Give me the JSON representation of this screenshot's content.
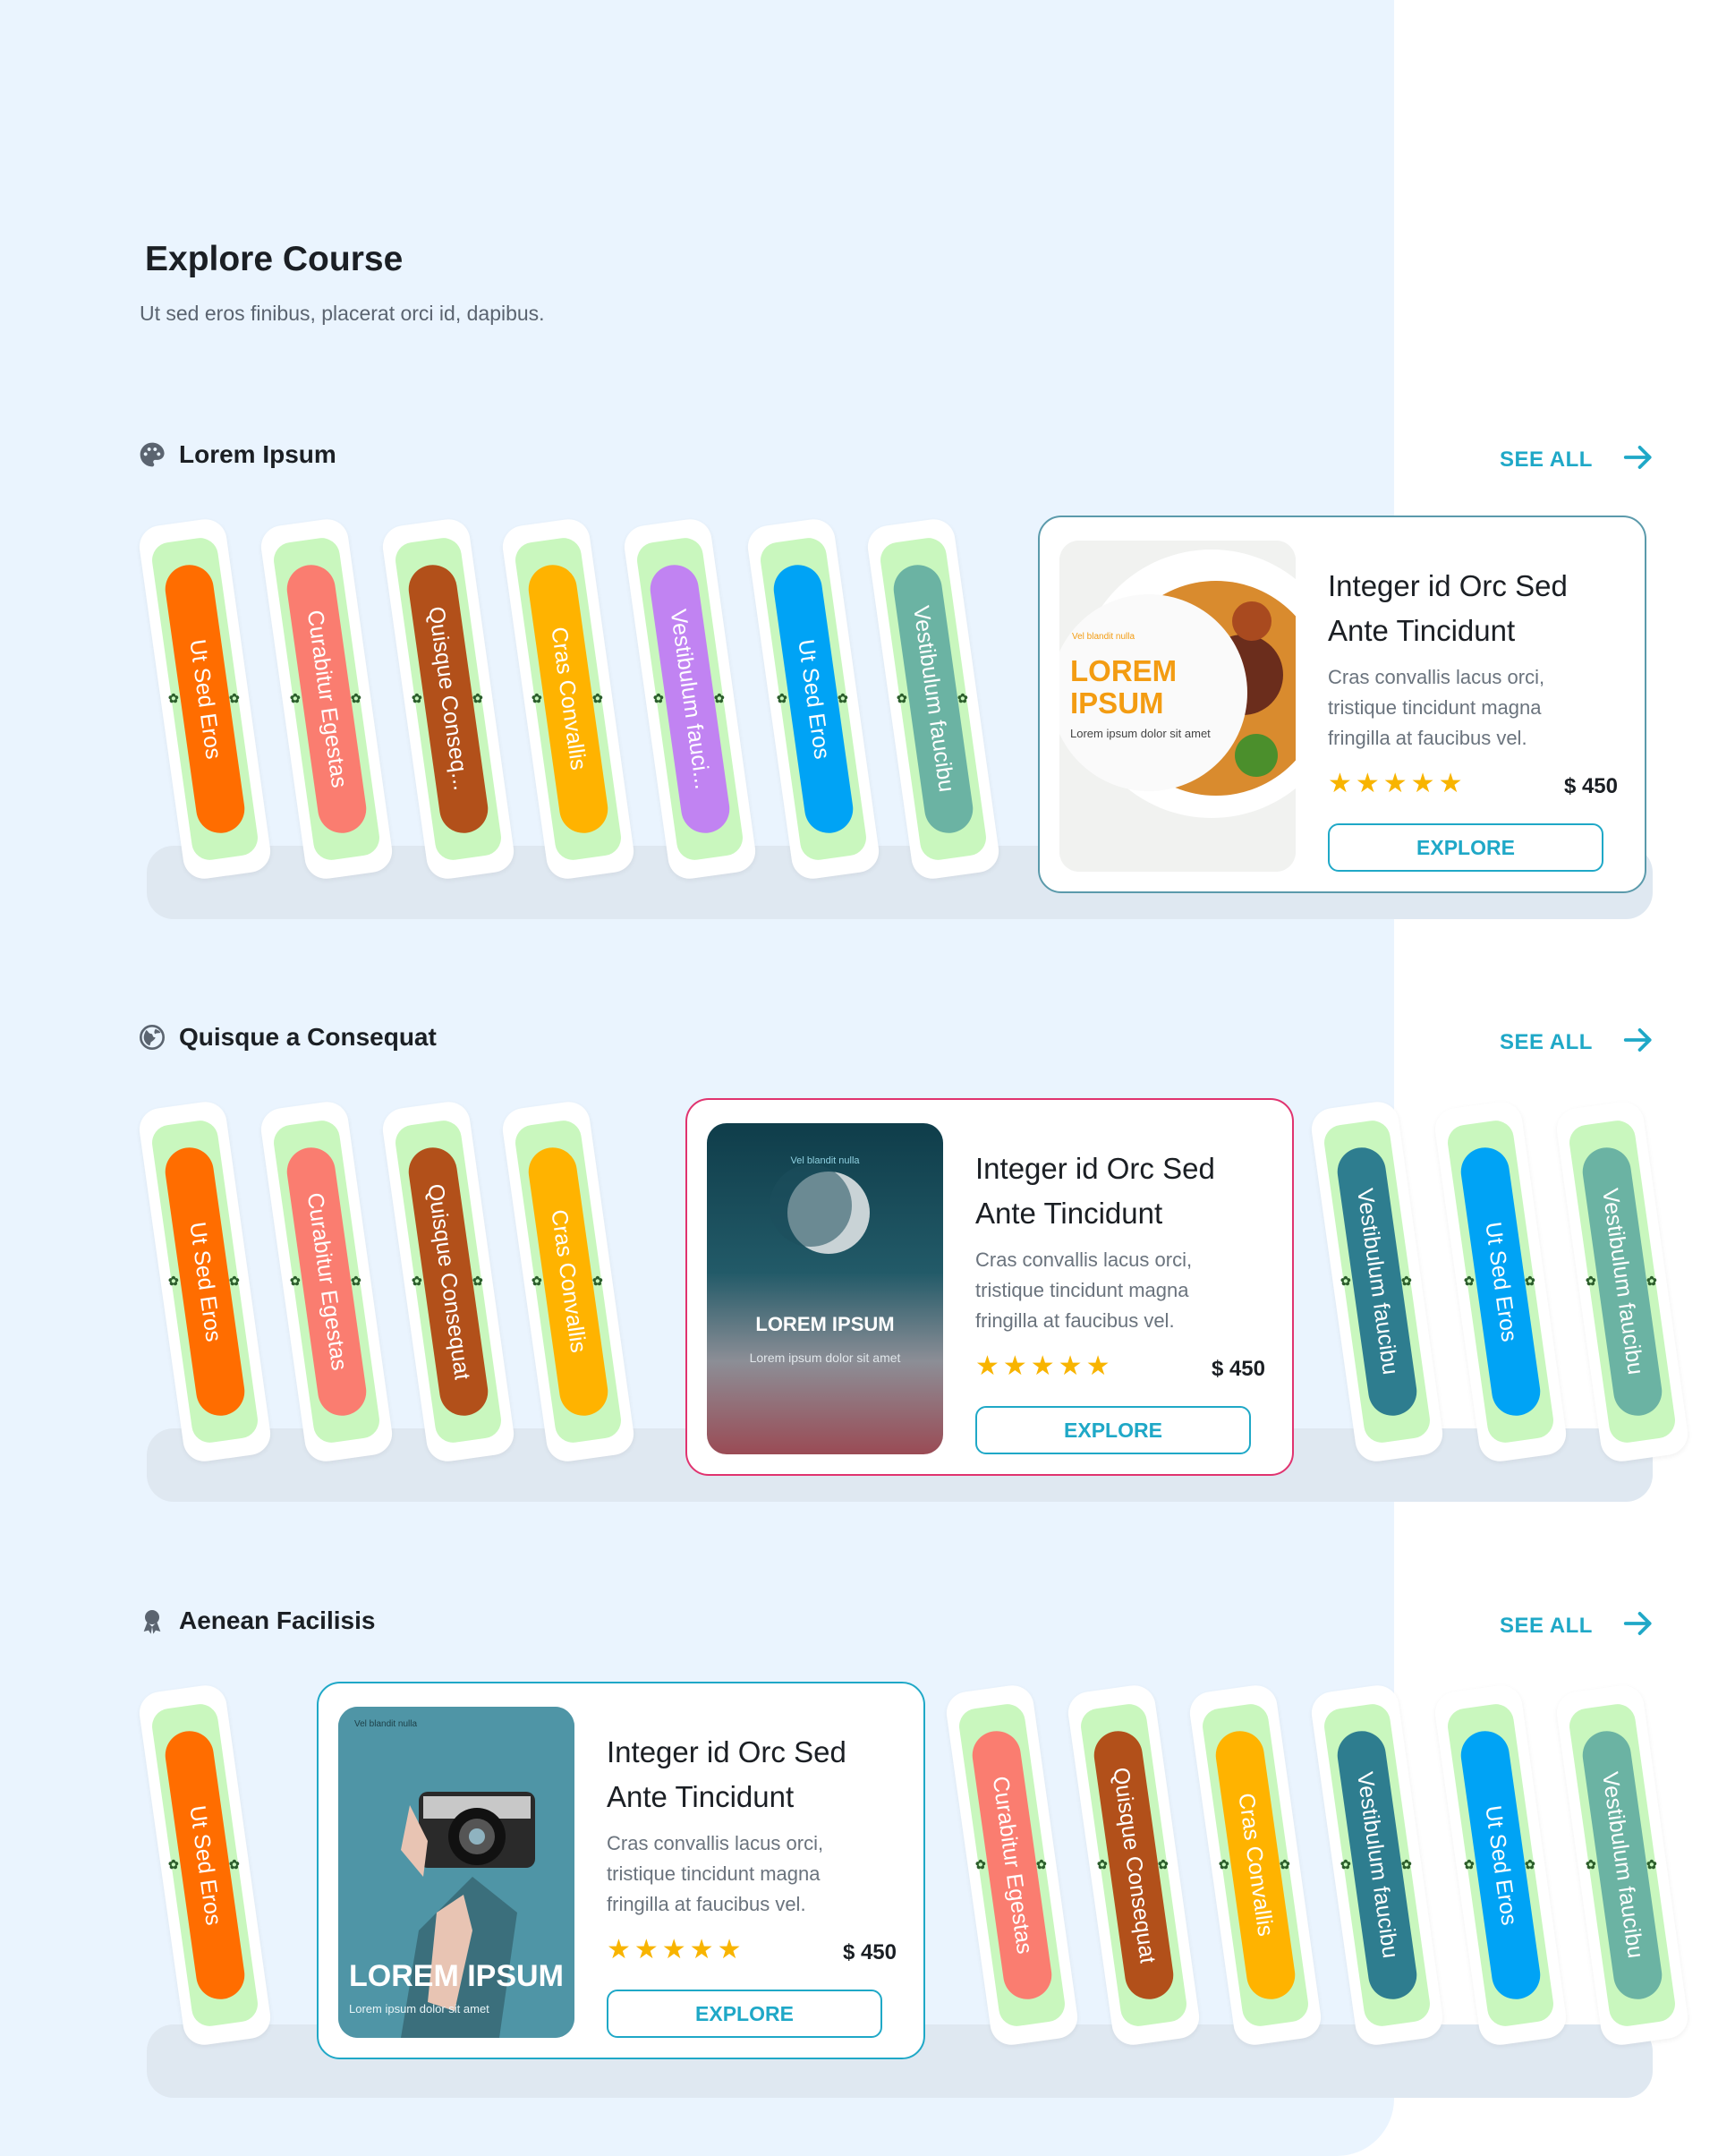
{
  "page": {
    "title": "Explore Course",
    "subtitle": "Ut sed eros finibus, placerat orci id, dapibus."
  },
  "colors": {
    "accent": "#1fa8c7",
    "background": "#eaf4fe",
    "star": "#f8b400",
    "spine_green": "#c9f7be"
  },
  "sections": [
    {
      "icon": "palette-icon",
      "title": "Lorem Ipsum",
      "see_all": "SEE ALL",
      "spines": [
        {
          "label": "Ut Sed Eros",
          "color": "#ff6d00"
        },
        {
          "label": "Curabitur Egestas",
          "color": "#fa7d70"
        },
        {
          "label": "Quisque Conseq...",
          "color": "#b2501a"
        },
        {
          "label": "Cras Convallis",
          "color": "#ffb300"
        },
        {
          "label": "Vestibulum fauci...",
          "color": "#c183f2"
        },
        {
          "label": "Ut Sed Eros",
          "color": "#00a3f5"
        },
        {
          "label": "Vestibulum faucibu",
          "color": "#6bb3a3"
        }
      ],
      "card": {
        "border": "#5b9aab",
        "title": "Integer id Orc Sed Ante Tincidunt",
        "description": "Cras convallis lacus orci, tristique tincidunt magna fringilla at faucibus vel.",
        "rating": "★★★★★",
        "price": "$ 450",
        "button": "EXPLORE",
        "cover": {
          "kicker": "Vel blandit nulla",
          "title": "LOREM IPSUM",
          "caption": "Lorem ipsum dolor sit amet"
        }
      }
    },
    {
      "icon": "globe-icon",
      "title": "Quisque a Consequat",
      "see_all": "SEE ALL",
      "spines_left": [
        {
          "label": "Ut Sed Eros",
          "color": "#ff6d00"
        },
        {
          "label": "Curabitur Egestas",
          "color": "#fa7d70"
        },
        {
          "label": "Quisque Consequat",
          "color": "#b2501a"
        },
        {
          "label": "Cras Convallis",
          "color": "#ffb300"
        }
      ],
      "spines_right": [
        {
          "label": "Vestibulum faucibu",
          "color": "#2e7d8f"
        },
        {
          "label": "Ut Sed Eros",
          "color": "#00a3f5"
        },
        {
          "label": "Vestibulum faucibu",
          "color": "#6bb3a3"
        }
      ],
      "card": {
        "border": "#e0336f",
        "title": "Integer id Orc Sed Ante Tincidunt",
        "description": "Cras convallis lacus orci, tristique tincidunt magna fringilla at faucibus vel.",
        "rating": "★★★★★",
        "price": "$ 450",
        "button": "EXPLORE",
        "cover": {
          "kicker": "Vel blandit nulla",
          "title": "LOREM IPSUM",
          "caption": "Lorem ipsum dolor sit amet"
        }
      }
    },
    {
      "icon": "award-icon",
      "title": "Aenean Facilisis",
      "see_all": "SEE ALL",
      "spines_left": [
        {
          "label": "Ut Sed Eros",
          "color": "#ff6d00"
        }
      ],
      "spines_right": [
        {
          "label": "Curabitur Egestas",
          "color": "#fa7d70"
        },
        {
          "label": "Quisque Consequat",
          "color": "#b2501a"
        },
        {
          "label": "Cras Convallis",
          "color": "#ffb300"
        },
        {
          "label": "Vestibulum faucibu",
          "color": "#2e7d8f"
        },
        {
          "label": "Ut Sed Eros",
          "color": "#00a3f5"
        },
        {
          "label": "Vestibulum faucibu",
          "color": "#6bb3a3"
        }
      ],
      "card": {
        "border": "#1fa8c7",
        "title": "Integer id Orc Sed Ante Tincidunt",
        "description": "Cras convallis lacus orci, tristique tincidunt magna fringilla at faucibus vel.",
        "rating": "★★★★★",
        "price": "$ 450",
        "button": "EXPLORE",
        "cover": {
          "kicker": "Vel blandit nulla",
          "title": "LOREM IPSUM",
          "caption": "Lorem ipsum dolor sit amet"
        }
      }
    }
  ]
}
